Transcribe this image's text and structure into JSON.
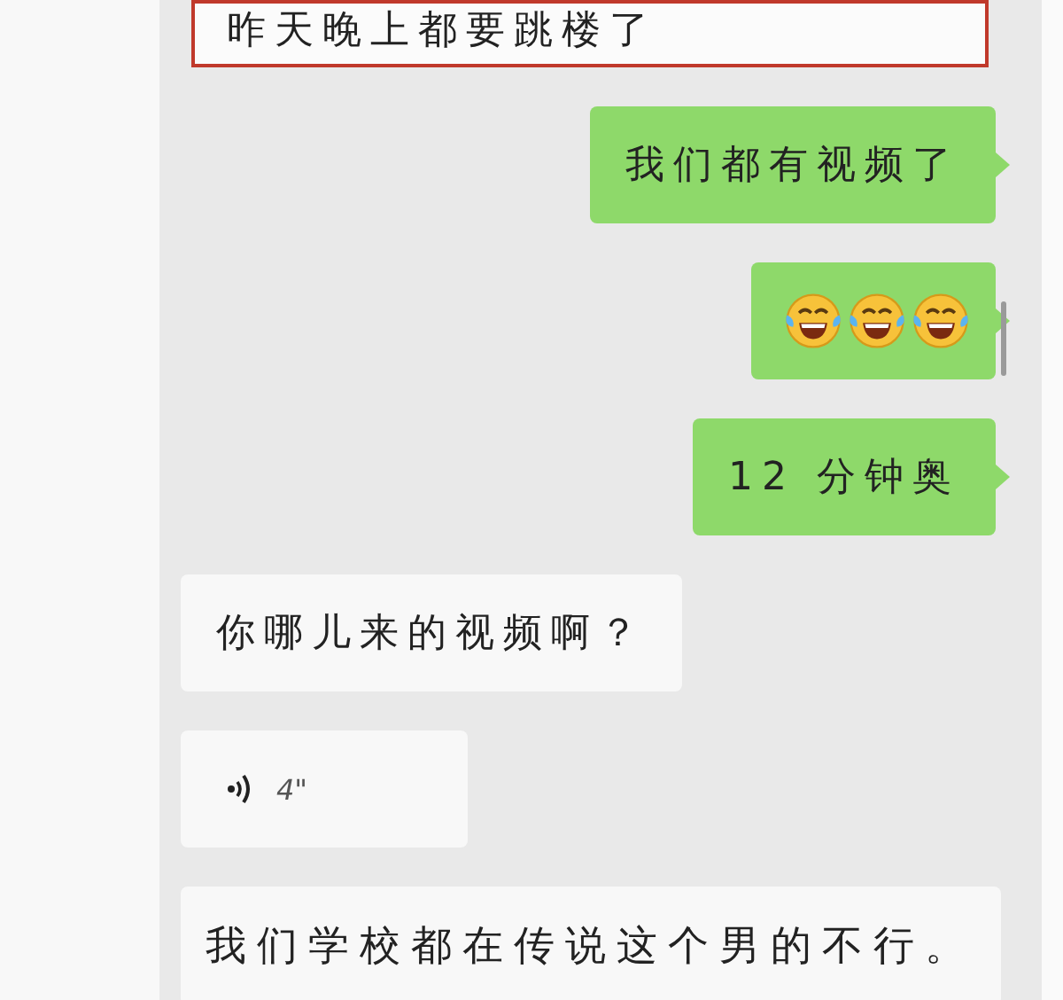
{
  "messages": [
    {
      "kind": "text",
      "outgoing": false,
      "highlighted": true,
      "text": "昨天晚上都要跳楼了"
    },
    {
      "kind": "text",
      "outgoing": true,
      "highlighted": false,
      "text": "我们都有视频了"
    },
    {
      "kind": "emoji",
      "outgoing": true,
      "highlighted": false,
      "emojis": [
        {
          "kind": "tears-of-joy"
        },
        {
          "kind": "tears-of-joy"
        },
        {
          "kind": "tears-of-joy"
        }
      ]
    },
    {
      "kind": "text",
      "outgoing": true,
      "highlighted": false,
      "text": "12 分钟奥"
    },
    {
      "kind": "text",
      "outgoing": false,
      "highlighted": false,
      "text": "你哪儿来的视频啊？"
    },
    {
      "kind": "voice",
      "outgoing": false,
      "highlighted": false,
      "duration": "4\""
    },
    {
      "kind": "text",
      "outgoing": false,
      "highlighted": false,
      "text": "我们学校都在传说这个男的不行。"
    }
  ]
}
